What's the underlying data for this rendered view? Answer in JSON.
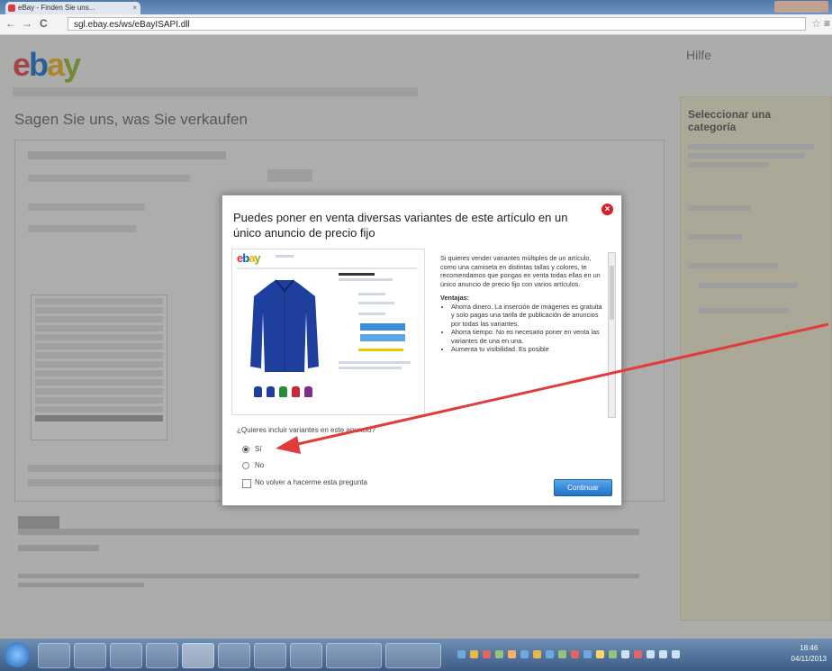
{
  "browser": {
    "tab_title": "eBay - Finden Sie uns...",
    "tab_close": "×",
    "url": "sgl.ebay.es/ws/eBayISAPI.dll",
    "nav_back": "←",
    "nav_forward": "→",
    "nav_reload": "C",
    "star": "☆",
    "menu": "≡"
  },
  "page": {
    "logo": [
      "e",
      "b",
      "a",
      "y"
    ],
    "help_link": "Hilfe",
    "title": "Sagen Sie uns, was Sie verkaufen",
    "sidebar_title": "Seleccionar una categoría"
  },
  "modal": {
    "title": "Puedes poner en venta diversas variantes de este artículo en un único anuncio de precio fijo",
    "close_icon": "×",
    "screenshot_logo": [
      "e",
      "b",
      "a",
      "y"
    ],
    "intro": "Si quieres vender variantes múltiples de un artículo, como una camiseta en distintas tallas y colores, te recomendamos que pongas en venta todas ellas en un único anuncio de precio fijo con varios artículos.",
    "advantages_title": "Ventajas:",
    "advantages": [
      "Ahorra dinero. La inserción de imágenes es gratuita y solo pagas una tarifa de publicación de anuncios por todas las variantes.",
      "Ahorra tiempo. No es necesario poner en venta las variantes de una en una.",
      "Aumenta tu visibilidad. Es posible"
    ],
    "question": "¿Quieres incluir variantes en este anuncio?",
    "option_yes": "Sí",
    "option_no": "No",
    "dont_ask": "No volver a hacerme esta pregunta",
    "continue_button": "Continuar"
  },
  "colors": {
    "arrow": "#e23b3b",
    "shirt": "#1f3f9e",
    "accent_button": "#1f74c7"
  },
  "swatches": [
    "#1f3f9e",
    "#1f3f9e",
    "#2a8a3c",
    "#c8283a",
    "#7b2f8a"
  ],
  "taskbar": {
    "clock_time": "18:46",
    "clock_date": "04/11/2013"
  }
}
